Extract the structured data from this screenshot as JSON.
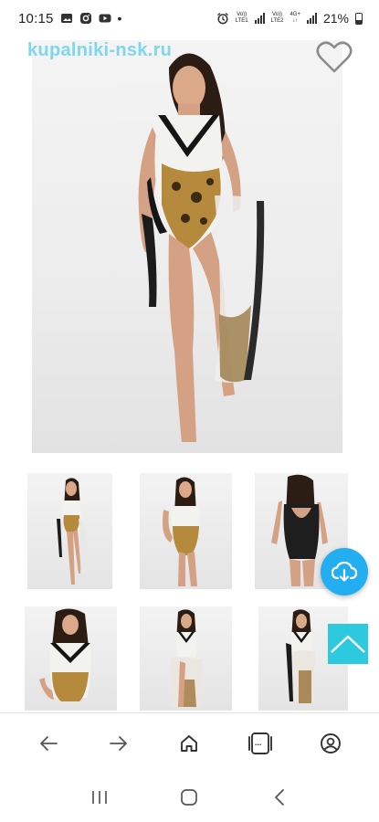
{
  "status_bar": {
    "time": "10:15",
    "dot": "•",
    "sim1_top": "Vo))",
    "sim1_bottom": "LTE1",
    "sim2_top": "Vo))",
    "sim2_bottom": "LTE2",
    "sim2_net": "4G+",
    "battery_percent": "21%",
    "icons": [
      "gallery-icon",
      "instagram-icon",
      "youtube-icon",
      "alarm-icon",
      "signal-icon",
      "battery-icon"
    ]
  },
  "site": {
    "logo": "kupalniki-nsk.ru"
  },
  "product": {
    "favorite_icon": "heart-outline-icon"
  },
  "colors": {
    "logo": "#7fd7ec",
    "download_fab": "#22aef0",
    "scroll_top": "#2cc9df"
  },
  "browser_toolbar": {
    "items": [
      "back-icon",
      "forward-icon",
      "home-icon",
      "tabs-icon",
      "account-icon"
    ],
    "tabs_label": "..."
  },
  "nav_bar": {
    "items": [
      "recent-apps-icon",
      "home-icon",
      "back-icon"
    ]
  }
}
